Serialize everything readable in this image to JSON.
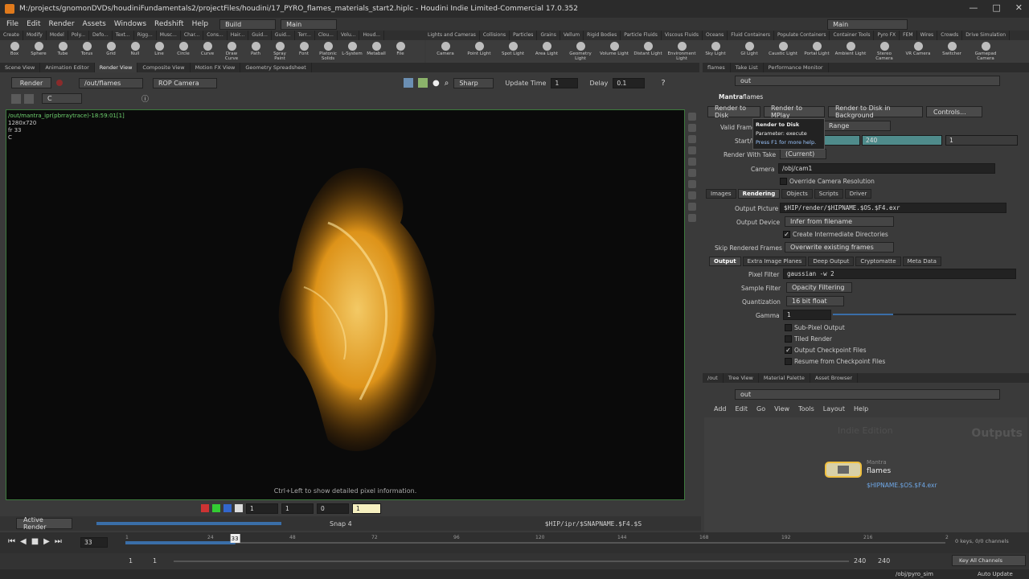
{
  "window": {
    "title": "M:/projects/gnomonDVDs/houdiniFundamentals2/projectFiles/houdini/17_PYRO_flames_materials_start2.hiplc - Houdini Indie Limited-Commercial 17.0.352",
    "controls": [
      "—",
      "□",
      "✕"
    ]
  },
  "menubar": {
    "items": [
      "File",
      "Edit",
      "Render",
      "Assets",
      "Windows",
      "Redshift",
      "Help"
    ],
    "build_label": "Build",
    "desktop_label": "Main",
    "desktop_right_label": "Main"
  },
  "shelf_tabs_left": [
    "Create",
    "Modify",
    "Model",
    "Poly...",
    "Defo...",
    "Text...",
    "Rigg...",
    "Musc...",
    "Char...",
    "Cons...",
    "Hair...",
    "Guid...",
    "Guid...",
    "Terr...",
    "Clou...",
    "Volu...",
    "Houd..."
  ],
  "shelf_tabs_right": [
    "Lights and Cameras",
    "Collisions",
    "Particles",
    "Grains",
    "Vellum",
    "Rigid Bodies",
    "Particle Fluids",
    "Viscous Fluids",
    "Oceans",
    "Fluid Containers",
    "Populate Containers",
    "Container Tools",
    "Pyro FX",
    "FEM",
    "Wires",
    "Crowds",
    "Drive Simulation"
  ],
  "shelf_tools_left": [
    "Box",
    "Sphere",
    "Tube",
    "Torus",
    "Grid",
    "Null",
    "Line",
    "Circle",
    "Curve",
    "Draw Curve",
    "Path",
    "Spray Paint",
    "Font",
    "Platonic Solids",
    "L-System",
    "Metaball",
    "File"
  ],
  "shelf_tools_right": [
    "Camera",
    "Point Light",
    "Spot Light",
    "Area Light",
    "Geometry Light",
    "Volume Light",
    "Distant Light",
    "Environment Light",
    "Sky Light",
    "GI Light",
    "Caustic Light",
    "Portal Light",
    "Ambient Light",
    "Stereo Camera",
    "VR Camera",
    "Switcher",
    "Gamepad Camera"
  ],
  "left_pane_tabs": [
    "Scene View",
    "Animation Editor",
    "Render View",
    "Composite View",
    "Motion FX View",
    "Geometry Spreadsheet"
  ],
  "left_pane_active": "Render View",
  "render_view": {
    "render_button": "Render",
    "rop_path": "/out/flames",
    "camera": "ROP Camera",
    "sharp_label": "Sharp",
    "update_time_label": "Update Time",
    "update_time_value": "1",
    "delay_label": "Delay",
    "delay_value": "0.1",
    "channel": "C"
  },
  "viewport": {
    "render_name": "/out/mantra_ipr(pbrraytrace)-18:59:01[1]",
    "resolution": "1280x720",
    "frame": "fr 33",
    "channel": "C",
    "hint": "Ctrl+Left to show detailed pixel information."
  },
  "viewport_bottom": {
    "field1": "1",
    "field2": "1",
    "field3": "0",
    "field4": "1"
  },
  "status_bar": {
    "active_render": "Active Render",
    "snap": "Snap 4",
    "snap_path": "$HIP/ipr/$SNAPNAME.$F4.$S"
  },
  "right_pane_tabs": [
    "flames",
    "Take List",
    "Performance Monitor"
  ],
  "params": {
    "path": "out",
    "node_type": "Mantra",
    "node_name": "flames",
    "buttons": [
      "Render to Disk",
      "Render to MPlay",
      "Render to Disk in Background",
      "Controls..."
    ],
    "tooltip": {
      "title": "Render to Disk",
      "param": "Parameter: execute",
      "help": "Press F1 for more help."
    },
    "valid_frame_label": "Valid Frame",
    "valid_frame_value": "Range",
    "start_end_label": "Start/E",
    "start_end_values": [
      "240",
      "1"
    ],
    "render_with_take_label": "Render With Take",
    "render_with_take_value": "(Current)",
    "camera_label": "Camera",
    "camera_value": "/obj/cam1",
    "override_res_label": "Override Camera Resolution",
    "main_tabs": [
      "Images",
      "Rendering",
      "Objects",
      "Scripts",
      "Driver"
    ],
    "main_tab_active": "Rendering",
    "output_picture_label": "Output Picture",
    "output_picture_value": "$HIP/render/$HIPNAME.$OS.$F4.exr",
    "output_device_label": "Output Device",
    "output_device_value": "Infer from filename",
    "create_dirs_label": "Create Intermediate Directories",
    "skip_frames_label": "Skip Rendered Frames",
    "skip_frames_value": "Overwrite existing frames",
    "sub_tabs": [
      "Output",
      "Extra Image Planes",
      "Deep Output",
      "Cryptomatte",
      "Meta Data"
    ],
    "sub_tab_active": "Output",
    "pixel_filter_label": "Pixel Filter",
    "pixel_filter_value": "gaussian -w 2",
    "sample_filter_label": "Sample Filter",
    "sample_filter_value": "Opacity Filtering",
    "quantization_label": "Quantization",
    "quantization_value": "16 bit float",
    "gamma_label": "Gamma",
    "gamma_value": "1",
    "subpixel_label": "Sub-Pixel Output",
    "tiled_label": "Tiled Render",
    "checkpoint_label": "Output Checkpoint Files",
    "resume_label": "Resume from Checkpoint Files"
  },
  "network_tabs": [
    "/out",
    "Tree View",
    "Material Palette",
    "Asset Browser"
  ],
  "network": {
    "path": "out",
    "menu": [
      "Add",
      "Edit",
      "Go",
      "View",
      "Tools",
      "Layout",
      "Help"
    ],
    "watermark": "Indie Edition",
    "context_label": "Outputs",
    "node_type": "Mantra",
    "node_name": "flames",
    "node_output": "$HIPNAME.$OS.$F4.exr"
  },
  "timeline": {
    "current_frame": "33",
    "ticks": [
      "1",
      "24",
      "48",
      "72",
      "96",
      "120",
      "144",
      "168",
      "192",
      "216",
      "240"
    ],
    "range_start": "1",
    "range_start2": "1",
    "range_end": "240",
    "range_end2": "240",
    "keys_label": "0 keys, 0/0 channels",
    "key_all_label": "Key All Channels",
    "obj_path": "/obj/pyro_sim",
    "auto_update": "Auto Update",
    "playhead_fraction": 0.134
  }
}
